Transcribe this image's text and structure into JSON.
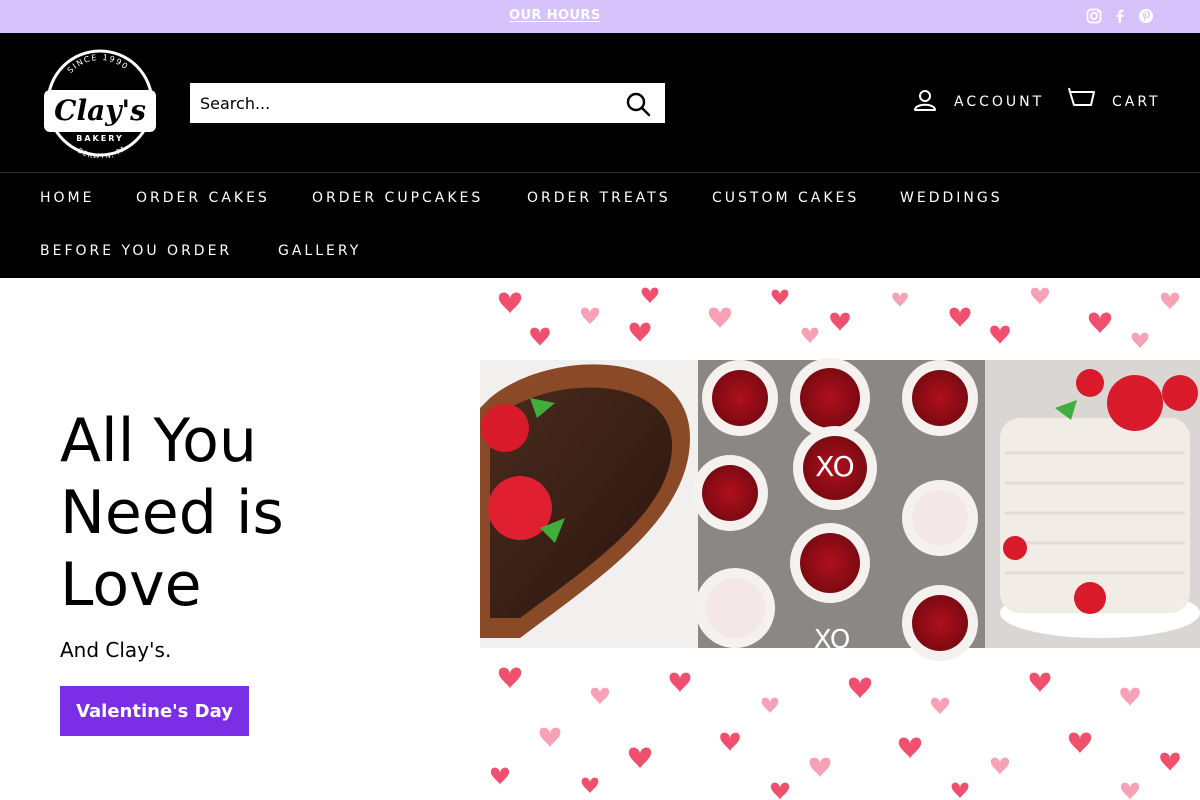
{
  "announcement": {
    "hours_link": "OUR HOURS"
  },
  "social": {
    "icons": [
      "instagram-icon",
      "facebook-icon",
      "pinterest-icon"
    ]
  },
  "header": {
    "search_placeholder": "Search...",
    "account_label": "ACCOUNT",
    "cart_label": "CART"
  },
  "nav": {
    "items": [
      "HOME",
      "ORDER CAKES",
      "ORDER CUPCAKES",
      "ORDER TREATS",
      "CUSTOM CAKES",
      "WEDDINGS",
      "BEFORE YOU ORDER",
      "GALLERY"
    ]
  },
  "hero": {
    "headline_line1": "All You",
    "headline_line2": "Need is",
    "headline_line3": "Love",
    "subheading": "And Clay's.",
    "cta_label": "Valentine's Day"
  },
  "logo": {
    "text_top": "SINCE 1990",
    "brand": "Clay's",
    "sub": "BAKERY",
    "text_bottom": "BERWYN, PA"
  },
  "colors": {
    "announce_bg": "#d8c2fb",
    "header_bg": "#000000",
    "cta_bg": "#7a2ee6"
  }
}
